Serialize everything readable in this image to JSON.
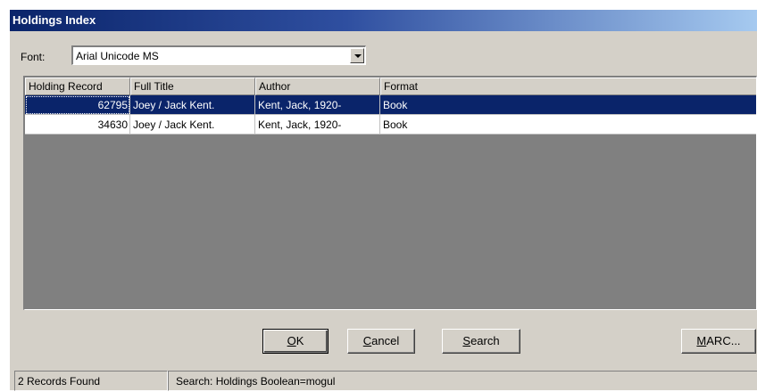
{
  "window": {
    "title": "Holdings Index"
  },
  "font": {
    "label": "Font:",
    "value": "Arial Unicode MS"
  },
  "grid": {
    "columns": [
      "Holding Record",
      "Full Title",
      "Author",
      "Format"
    ],
    "rows": [
      {
        "record": "62795",
        "title": "Joey / Jack Kent.",
        "author": "Kent, Jack, 1920-",
        "format": "Book",
        "selected": true
      },
      {
        "record": "34630",
        "title": "Joey / Jack Kent.",
        "author": "Kent, Jack, 1920-",
        "format": "Book",
        "selected": false
      }
    ]
  },
  "buttons": {
    "ok": {
      "mnemonic": "O",
      "rest": "K"
    },
    "cancel": {
      "mnemonic": "C",
      "rest": "ancel"
    },
    "search": {
      "mnemonic": "S",
      "rest": "earch"
    },
    "marc": {
      "mnemonic": "M",
      "rest": "ARC..."
    }
  },
  "status": {
    "count": "2 Records Found",
    "search": "Search: Holdings Boolean=mogul"
  }
}
